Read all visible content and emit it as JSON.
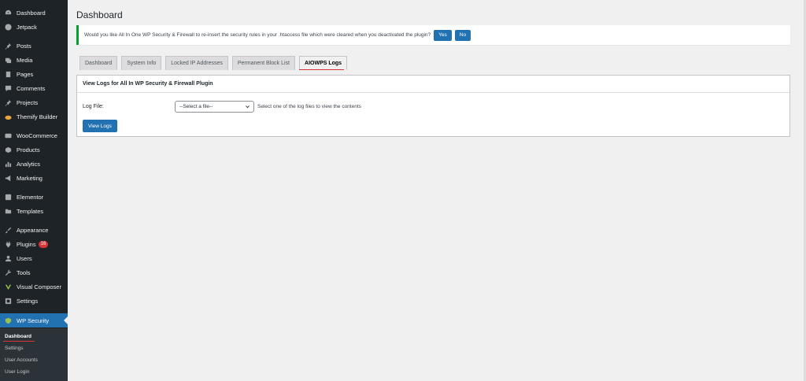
{
  "sidebar": {
    "items": [
      {
        "label": "Dashboard",
        "icon": "dashboard-icon"
      },
      {
        "label": "Jetpack",
        "icon": "jetpack-icon"
      },
      {
        "label": "Posts",
        "icon": "pin-icon"
      },
      {
        "label": "Media",
        "icon": "media-icon"
      },
      {
        "label": "Pages",
        "icon": "page-icon"
      },
      {
        "label": "Comments",
        "icon": "comment-icon"
      },
      {
        "label": "Projects",
        "icon": "pin-icon"
      },
      {
        "label": "Themify Builder",
        "icon": "themify-icon"
      },
      {
        "label": "WooCommerce",
        "icon": "woocommerce-icon"
      },
      {
        "label": "Products",
        "icon": "products-icon"
      },
      {
        "label": "Analytics",
        "icon": "analytics-icon"
      },
      {
        "label": "Marketing",
        "icon": "megaphone-icon"
      },
      {
        "label": "Elementor",
        "icon": "elementor-icon"
      },
      {
        "label": "Templates",
        "icon": "folder-icon"
      },
      {
        "label": "Appearance",
        "icon": "brush-icon"
      },
      {
        "label": "Plugins",
        "icon": "plugin-icon",
        "badge": "16"
      },
      {
        "label": "Users",
        "icon": "users-icon"
      },
      {
        "label": "Tools",
        "icon": "wrench-icon"
      },
      {
        "label": "Visual Composer",
        "icon": "vc-icon"
      },
      {
        "label": "Settings",
        "icon": "settings-icon"
      },
      {
        "label": "WP Security",
        "icon": "shield-icon"
      }
    ],
    "submenu": [
      "Dashboard",
      "Settings",
      "User Accounts",
      "User Login"
    ]
  },
  "page": {
    "title": "Dashboard"
  },
  "notice": {
    "text": "Would you like All In One WP Security & Firewall to re-insert the security rules in your .htaccess file which were cleared when you deactivated the plugin?",
    "yes": "Yes",
    "no": "No",
    "accent": "#00a32a"
  },
  "tabs": [
    "Dashboard",
    "System Info",
    "Locked IP Addresses",
    "Permanent Block List",
    "AIOWPS Logs"
  ],
  "active_tab": "AIOWPS Logs",
  "panel": {
    "title": "View Logs for All In WP Security & Firewall Plugin",
    "log_label": "Log File:",
    "select_value": "--Select a file--",
    "hint": "Select one of the log files to view the contents",
    "button": "View Logs"
  },
  "colors": {
    "sidebar_bg": "#1d2327",
    "active_blue": "#2271b1",
    "badge_red": "#d63638",
    "highlight_underline": "#d63638"
  }
}
